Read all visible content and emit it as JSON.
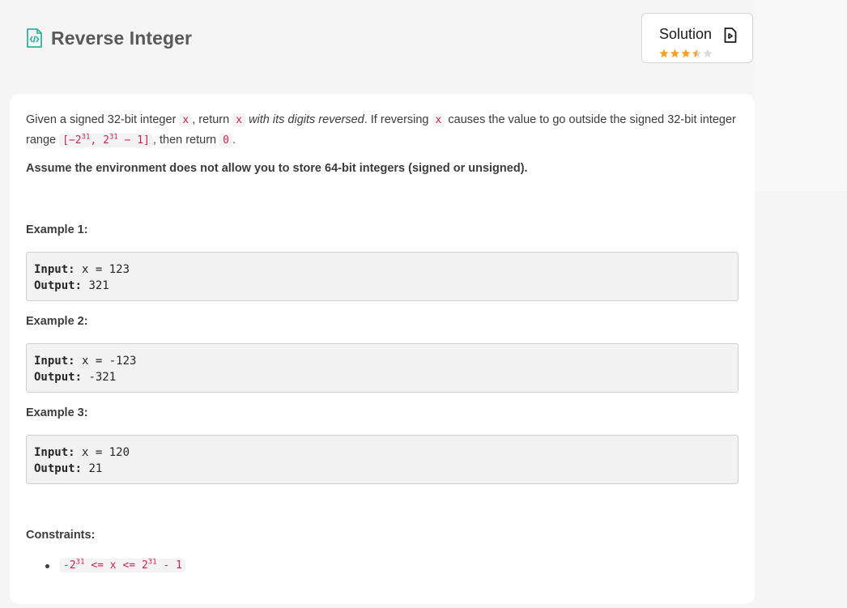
{
  "problem": {
    "title": "Reverse Integer",
    "title_icon": "code-file-icon"
  },
  "solution_button": {
    "label": "Solution",
    "icon": "document-icon",
    "rating": 3.5,
    "rating_max": 5,
    "star_color": "#f59f23"
  },
  "description": {
    "text_1": "Given a signed 32-bit integer ",
    "code_x": "x",
    "text_2": ", return ",
    "text_3_italic": "with its digits reversed",
    "text_4": ". If reversing ",
    "text_5": " causes the value to go outside the signed 32-bit integer range ",
    "range_a": "[−2",
    "range_exp1": "31",
    "range_b": ", 2",
    "range_exp2": "31",
    "range_c": " − 1]",
    "text_6": ", then return ",
    "code_zero": "0",
    "text_7": ".",
    "bold_note": "Assume the environment does not allow you to store 64-bit integers (signed or unsigned)."
  },
  "examples": [
    {
      "label": "Example 1:",
      "input_label": "Input:",
      "input": " x = 123",
      "output_label": "Output:",
      "output": " 321"
    },
    {
      "label": "Example 2:",
      "input_label": "Input:",
      "input": " x = -123",
      "output_label": "Output:",
      "output": " -321"
    },
    {
      "label": "Example 3:",
      "input_label": "Input:",
      "input": " x = 120",
      "output_label": "Output:",
      "output": " 21"
    }
  ],
  "constraints": {
    "label": "Constraints:",
    "item_a": "-2",
    "item_exp1": "31",
    "item_b": " <= x <= 2",
    "item_exp2": "31",
    "item_c": " - 1"
  }
}
